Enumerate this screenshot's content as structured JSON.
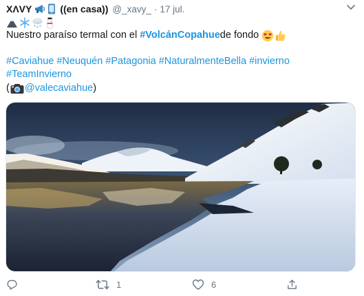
{
  "tweet": {
    "display_name": "XΛVY",
    "name_suffix": "((en casa))",
    "handle": "@_xavy_",
    "separator": "·",
    "time": "17 jul.",
    "text_intro": "Nuestro paraíso termal con el ",
    "text_bold_tag": "#VolcánCopahue",
    "text_after": " de fondo",
    "hashtags_line1": "#Caviahue #Neuquén #Patagonia #NaturalmenteBella #invierno",
    "hashtags_line2": "#TeamInvierno",
    "credit_open": "(",
    "credit_handle": "@valecaviahue",
    "credit_close": ")"
  },
  "icons": {
    "name_emojis": [
      "megaphone-icon",
      "phone-icon"
    ],
    "line_emojis": [
      "mountain-icon",
      "snowflake-icon",
      "cloud-snow-icon",
      "snowman-icon"
    ],
    "text_emojis": [
      "heart-eyes-icon",
      "thumbs-up-icon"
    ],
    "credit_emoji": "camera-icon"
  },
  "actions": {
    "reply_count": "",
    "retweet_count": "1",
    "like_count": "6",
    "share_count": ""
  },
  "colors": {
    "link": "#1b95e0",
    "muted": "#657786",
    "text": "#14171a"
  }
}
